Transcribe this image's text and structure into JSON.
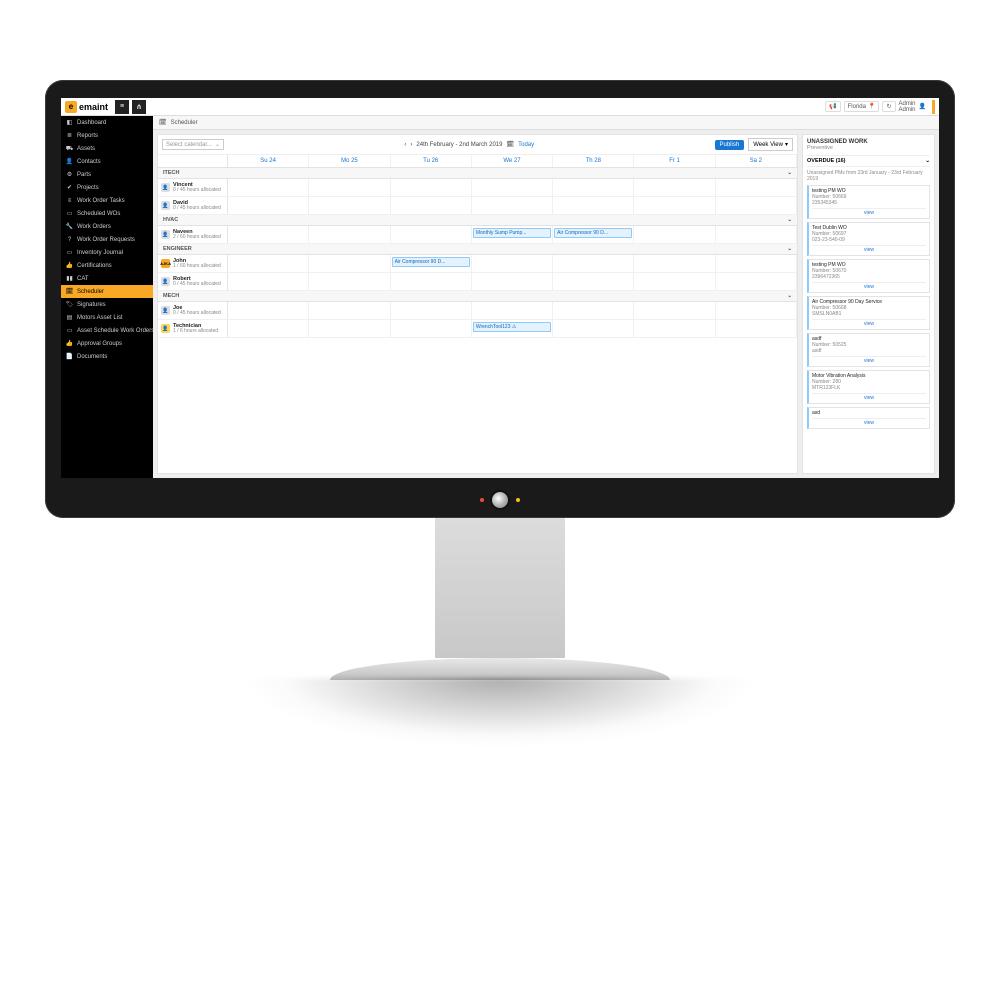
{
  "brand": {
    "logo_letter": "e",
    "name": "emaint"
  },
  "topbar": {
    "location": "Florida",
    "user_line1": "Admin",
    "user_line2": "Admin"
  },
  "sidebar": {
    "items": [
      {
        "label": "Dashboard",
        "icon": "◧"
      },
      {
        "label": "Reports",
        "icon": "≣"
      },
      {
        "label": "Assets",
        "icon": "⛟"
      },
      {
        "label": "Contacts",
        "icon": "👤"
      },
      {
        "label": "Parts",
        "icon": "⚙"
      },
      {
        "label": "Projects",
        "icon": "✔"
      },
      {
        "label": "Work Order Tasks",
        "icon": "≡"
      },
      {
        "label": "Scheduled WOs",
        "icon": "▭"
      },
      {
        "label": "Work Orders",
        "icon": "🔧"
      },
      {
        "label": "Work Order Requests",
        "icon": "?"
      },
      {
        "label": "Inventory Journal",
        "icon": "▭"
      },
      {
        "label": "Certifications",
        "icon": "👍"
      },
      {
        "label": "CAT",
        "icon": "▮▮"
      },
      {
        "label": "Scheduler",
        "icon": "🗓",
        "active": true
      },
      {
        "label": "Signatures",
        "icon": "🏷"
      },
      {
        "label": "Motors Asset List",
        "icon": "▤"
      },
      {
        "label": "Asset Schedule Work Orders",
        "icon": "▭"
      },
      {
        "label": "Approval Groups",
        "icon": "👍"
      },
      {
        "label": "Documents",
        "icon": "📄"
      }
    ]
  },
  "breadcrumb": {
    "title": "Scheduler"
  },
  "toolbar": {
    "select_placeholder": "Select calendar...",
    "date_range": "24th February - 2nd March 2019",
    "today": "Today",
    "publish": "Publish",
    "view_mode": "Week View"
  },
  "calendar": {
    "days": [
      "Su 24",
      "Mo 25",
      "Tu 26",
      "We 27",
      "Th 28",
      "Fr 1",
      "Sa 2"
    ],
    "groups": [
      {
        "name": "ITECH",
        "people": [
          {
            "name": "Vincent",
            "sub": "0 / 45 hours allocated",
            "avatar": "person",
            "events": {}
          },
          {
            "name": "David",
            "sub": "0 / 45 hours allocated",
            "avatar": "person",
            "events": {}
          }
        ]
      },
      {
        "name": "HVAC",
        "people": [
          {
            "name": "Naveen",
            "sub": "2 / 60 hours allocated",
            "avatar": "person",
            "events": {
              "3": [
                "Monthly Sump Pump..."
              ],
              "4": [
                "Air Compressor 90 D..."
              ]
            }
          }
        ]
      },
      {
        "name": "ENGINEER",
        "people": [
          {
            "name": "John",
            "sub": "1 / 60 hours allocated",
            "avatar": "badge",
            "badge_text": "AJKA",
            "events": {
              "2": [
                "Air Compressor 90 D..."
              ]
            }
          },
          {
            "name": "Robert",
            "sub": "0 / 45 hours allocated",
            "avatar": "person",
            "events": {}
          }
        ]
      },
      {
        "name": "MECH",
        "people": [
          {
            "name": "Joe",
            "sub": "0 / 45 hours allocated",
            "avatar": "person",
            "events": {}
          },
          {
            "name": "Technician",
            "sub": "1 / 6 hours allocated",
            "avatar": "yellow",
            "events": {
              "3": [
                "WrenchTool123 ⚠"
              ]
            }
          }
        ]
      }
    ]
  },
  "unassigned": {
    "header": "UNASSIGNED WORK",
    "subheader": "Preventive",
    "overdue_label": "OVERDUE (16)",
    "range": "Unassigned PMs from 23rd January - 23rd February 2019",
    "cards": [
      {
        "title": "testing PM WO",
        "number": "Number: 50669",
        "ref": "235345345"
      },
      {
        "title": "Test Dublin WO",
        "number": "Number: 50697",
        "ref": "023-23-540-09"
      },
      {
        "title": "testing PM WO",
        "number": "Number: 50670",
        "ref": "2396472365"
      },
      {
        "title": "Air Compressor 90 Day Service",
        "number": "Number: 50668",
        "ref": "SMSLN0AB1"
      },
      {
        "title": "asdf",
        "number": "Number: 50525",
        "ref": "asdf"
      },
      {
        "title": "Motor Vibration Analysis",
        "number": "Number: 280",
        "ref": "MTR123FLK"
      },
      {
        "title": "asd",
        "number": "",
        "ref": ""
      }
    ],
    "view_label": "view"
  }
}
